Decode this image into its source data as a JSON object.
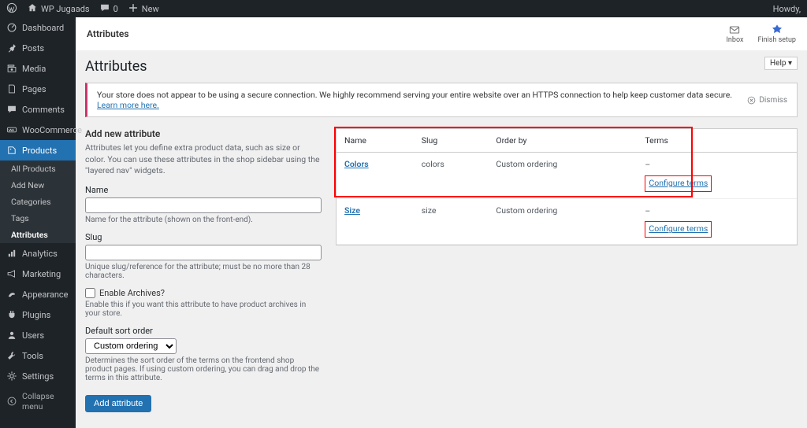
{
  "topbar": {
    "site_name": "WP Jugaads",
    "comment_count": "0",
    "new_label": "New",
    "howdy": "Howdy,"
  },
  "sidebar": {
    "dashboard": "Dashboard",
    "posts": "Posts",
    "media": "Media",
    "pages": "Pages",
    "comments": "Comments",
    "woocommerce": "WooCommerce",
    "products": "Products",
    "sub": {
      "all_products": "All Products",
      "add_new": "Add New",
      "categories": "Categories",
      "tags": "Tags",
      "attributes": "Attributes"
    },
    "analytics": "Analytics",
    "marketing": "Marketing",
    "appearance": "Appearance",
    "plugins": "Plugins",
    "users": "Users",
    "tools": "Tools",
    "settings": "Settings",
    "collapse": "Collapse menu"
  },
  "header": {
    "title": "Attributes",
    "inbox": "Inbox",
    "finish_setup": "Finish setup"
  },
  "help_tab": "Help ▾",
  "page_title": "Attributes",
  "notice": {
    "text": "Your store does not appear to be using a secure connection. We highly recommend serving your entire website over an HTTPS connection to help keep customer data secure. ",
    "learn_more": "Learn more here.",
    "dismiss": "Dismiss"
  },
  "form": {
    "section_title": "Add new attribute",
    "intro": "Attributes let you define extra product data, such as size or color. You can use these attributes in the shop sidebar using the \"layered nav\" widgets.",
    "name_label": "Name",
    "name_help": "Name for the attribute (shown on the front-end).",
    "slug_label": "Slug",
    "slug_help": "Unique slug/reference for the attribute; must be no more than 28 characters.",
    "archives_label": "Enable Archives?",
    "archives_help": "Enable this if you want this attribute to have product archives in your store.",
    "sort_label": "Default sort order",
    "sort_value": "Custom ordering",
    "sort_help": "Determines the sort order of the terms on the frontend shop product pages. If using custom ordering, you can drag and drop the terms in this attribute.",
    "submit": "Add attribute"
  },
  "table": {
    "head": {
      "name": "Name",
      "slug": "Slug",
      "order_by": "Order by",
      "terms": "Terms"
    },
    "rows": [
      {
        "name": "Colors",
        "slug": "colors",
        "order_by": "Custom ordering",
        "terms_placeholder": "–",
        "configure": "Configure terms"
      },
      {
        "name": "Size",
        "slug": "size",
        "order_by": "Custom ordering",
        "terms_placeholder": "–",
        "configure": "Configure terms"
      }
    ]
  }
}
